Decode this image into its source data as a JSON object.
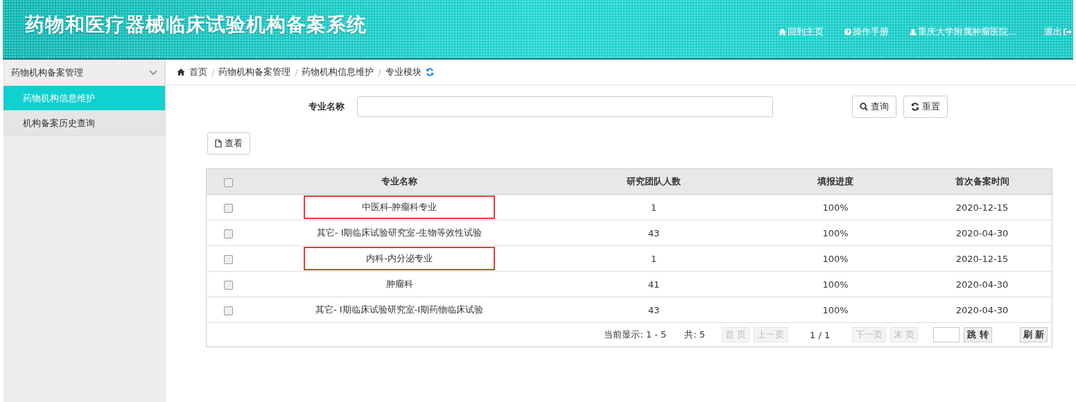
{
  "header": {
    "title": "药物和医疗器械临床试验机构备案系统",
    "links": [
      {
        "kind": "home",
        "label": "回到主页"
      },
      {
        "kind": "help",
        "label": "操作手册"
      },
      {
        "kind": "user",
        "label": "重庆大学附属肿瘤医院..."
      },
      {
        "kind": "logout",
        "label": "退出"
      }
    ]
  },
  "sidebar": {
    "group": {
      "label": "药物机构备案管理",
      "expanded": true
    },
    "items": [
      {
        "label": "药物机构信息维护",
        "selected": true
      },
      {
        "label": "机构备案历史查询",
        "selected": false
      }
    ]
  },
  "breadcrumb": {
    "separator": "/",
    "items": [
      "首页",
      "药物机构备案管理",
      "药物机构信息维护",
      "专业模块"
    ]
  },
  "search": {
    "label": "专业名称",
    "buttons": [
      {
        "kind": "search",
        "label": "查询"
      },
      {
        "kind": "reset",
        "label": "重置"
      }
    ]
  },
  "toolbar": {
    "view_button": "查看"
  },
  "table": {
    "columns": [
      "专业名称",
      "研究团队人数",
      "填报进度",
      "首次备案时间"
    ],
    "header_checked": false,
    "rows": [
      {
        "checked": false,
        "highlighted": true,
        "cells": [
          "中医科-肿瘤科专业",
          "1",
          "100%",
          "2020-12-15"
        ]
      },
      {
        "checked": false,
        "highlighted": false,
        "cells": [
          "其它- Ⅰ期临床试验研究室-生物等效性试验",
          "43",
          "100%",
          "2020-04-30"
        ]
      },
      {
        "checked": false,
        "highlighted": true,
        "cells": [
          "内科-内分泌专业",
          "1",
          "100%",
          "2020-12-15"
        ]
      },
      {
        "checked": false,
        "highlighted": false,
        "cells": [
          "肿瘤科",
          "41",
          "100%",
          "2020-04-30"
        ]
      },
      {
        "checked": false,
        "highlighted": false,
        "cells": [
          "其它- Ⅰ期临床试验研究室-I期药物临床试验",
          "43",
          "100%",
          "2020-04-30"
        ]
      }
    ]
  },
  "pager": {
    "showing": "当前显示: 1 - 5",
    "total": "共: 5",
    "first": {
      "label": "首 页",
      "disabled": true
    },
    "prev": {
      "label": "上一页",
      "disabled": true
    },
    "page": "1 / 1",
    "next": {
      "label": "下一页",
      "disabled": true
    },
    "last": {
      "label": "末 页",
      "disabled": true
    },
    "jump": "跳 转",
    "refresh": "刷 新"
  }
}
